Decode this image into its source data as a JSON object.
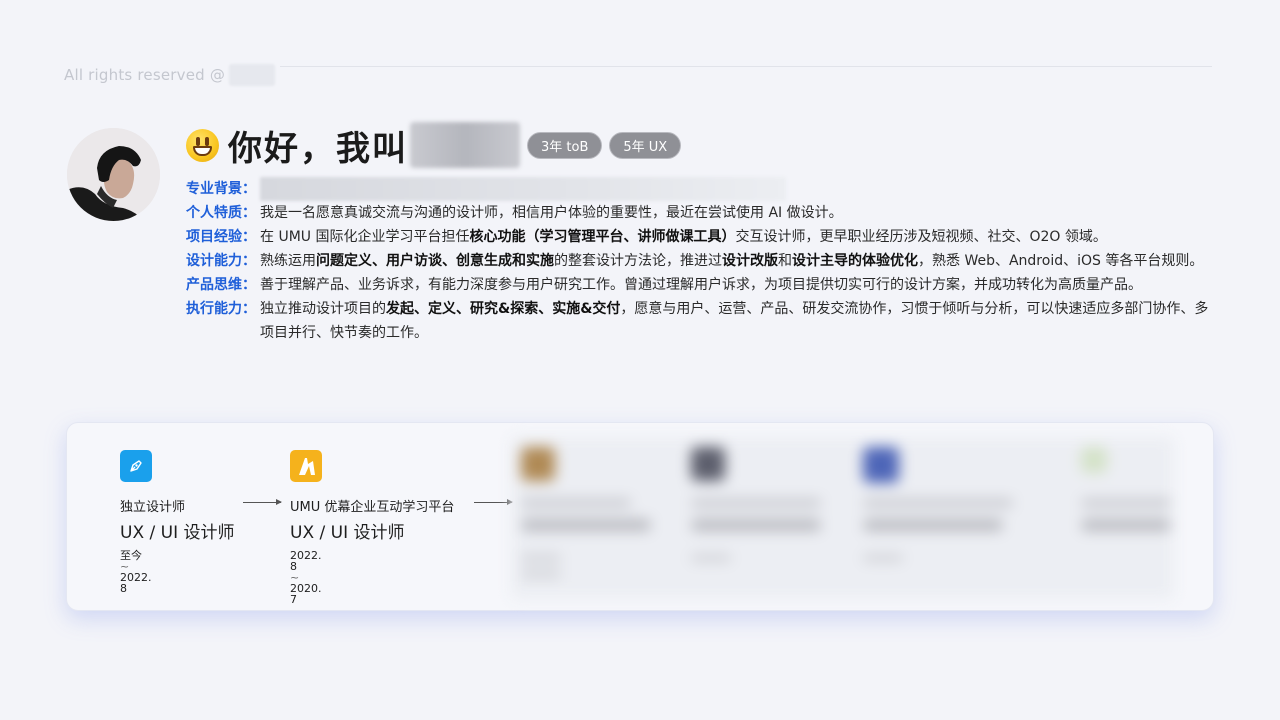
{
  "copyright": "All rights reserved @",
  "header": {
    "greeting": "你好，我叫",
    "tags": [
      "3年 toB",
      "5年 UX"
    ]
  },
  "profile": [
    {
      "label": "专业背景：",
      "segments": []
    },
    {
      "label": "个人特质：",
      "segments": [
        {
          "t": "我是一名愿意真诚交流与沟通的设计师，相信用户体验的重要性，最近在尝试使用 AI 做设计。"
        }
      ]
    },
    {
      "label": "项目经验：",
      "segments": [
        {
          "t": "在 UMU 国际化企业学习平台担任"
        },
        {
          "t": "核心功能（学习管理平台、讲师做课工具）",
          "b": true
        },
        {
          "t": "交互设计师，更早职业经历涉及短视频、社交、O2O 领域。"
        }
      ]
    },
    {
      "label": "设计能力：",
      "segments": [
        {
          "t": "熟练运用"
        },
        {
          "t": "问题定义、用户访谈、创意生成和实施",
          "b": true
        },
        {
          "t": "的整套设计方法论，推进过"
        },
        {
          "t": "设计改版",
          "b": true
        },
        {
          "t": "和"
        },
        {
          "t": "设计主导的体验优化",
          "b": true
        },
        {
          "t": "，熟悉 Web、Android、iOS 等各平台规则。"
        }
      ]
    },
    {
      "label": "产品思维：",
      "segments": [
        {
          "t": "善于理解产品、业务诉求，有能力深度参与用户研究工作。曾通过理解用户诉求，为项目提供切实可行的设计方案，并成功转化为高质量产品。"
        }
      ]
    },
    {
      "label": "执行能力：",
      "segments": [
        {
          "t": "独立推动设计项目的"
        },
        {
          "t": "发起、定义、研究&探索、实施&交付",
          "b": true
        },
        {
          "t": "，愿意与用户、运营、产品、研发交流协作，习惯于倾听与分析，可以快速适应多部门协作、多项目并行、快节奏的工作。"
        }
      ]
    }
  ],
  "experience": [
    {
      "company": "独立设计师",
      "title": "UX / UI 设计师",
      "date_start": "至今",
      "date_end": "2022. 8",
      "tilde": "~",
      "logo_color": "#1aa0ec",
      "logo_icon": "pen-nib-icon"
    },
    {
      "company": "UMU 优幕企业互动学习平台",
      "title": "UX / UI 设计师",
      "date_start": "2022. 8",
      "date_end": "2020. 7",
      "tilde": "~",
      "logo_color": "#f5b21c",
      "logo_icon": "umu-logo-icon"
    }
  ],
  "colors": {
    "accent": "#1f5fd9",
    "tag_bg": "#8f9096",
    "card_glow": "#7a8fe8"
  }
}
